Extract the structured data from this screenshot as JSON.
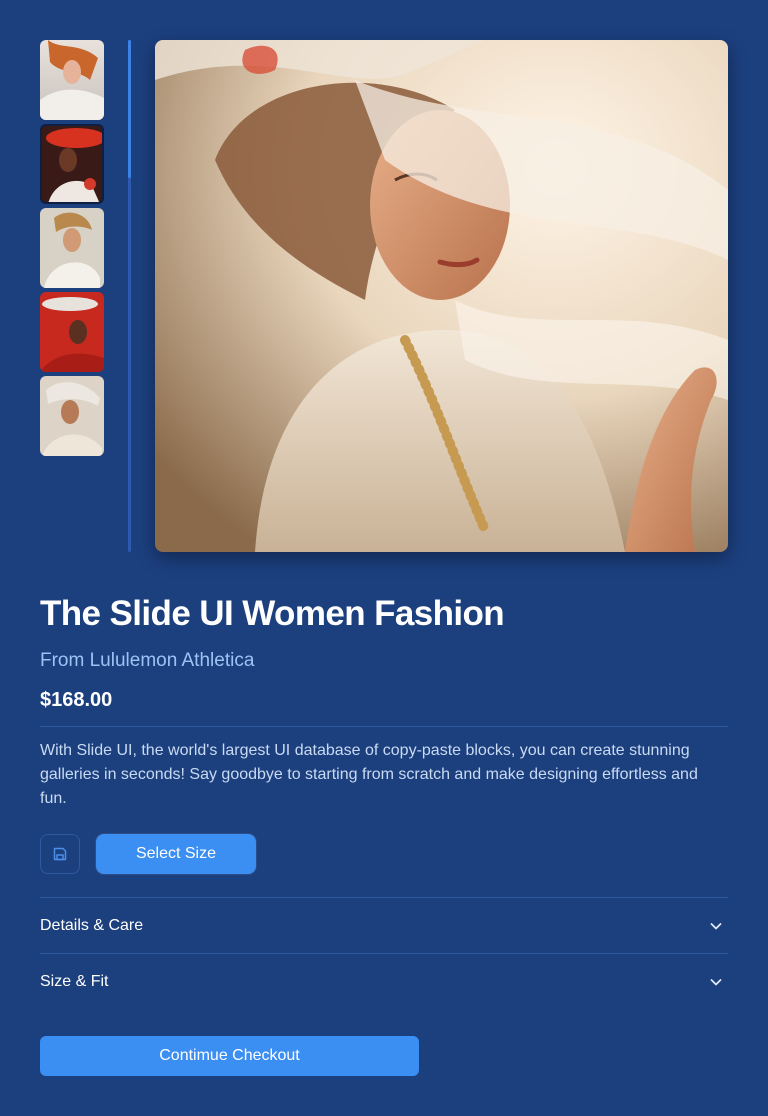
{
  "gallery": {
    "thumbnails": [
      {
        "alt": "thumbnail-1"
      },
      {
        "alt": "thumbnail-2"
      },
      {
        "alt": "thumbnail-3"
      },
      {
        "alt": "thumbnail-4"
      },
      {
        "alt": "thumbnail-5"
      }
    ],
    "active_index": 1,
    "scroll_fraction": 0.27
  },
  "product": {
    "title": "The Slide UI Women Fashion",
    "brand": "From Lululemon Athletica",
    "price": "$168.00",
    "description": "With Slide UI, the world's largest UI database of copy-paste blocks, you can create stunning galleries in seconds! Say goodbye to starting from scratch and make designing effortless and fun."
  },
  "actions": {
    "save_icon": "save-icon",
    "select_size_label": "Select Size"
  },
  "accordion": [
    {
      "label": "Details & Care",
      "icon": "chevron-down-icon"
    },
    {
      "label": "Size & Fit",
      "icon": "chevron-down-icon"
    }
  ],
  "checkout": {
    "label": "Contimue Checkout"
  },
  "colors": {
    "background": "#1c3f7e",
    "accent": "#3b8ef2",
    "brand_text": "#9dc3f5",
    "divider": "#2f5aa0"
  }
}
